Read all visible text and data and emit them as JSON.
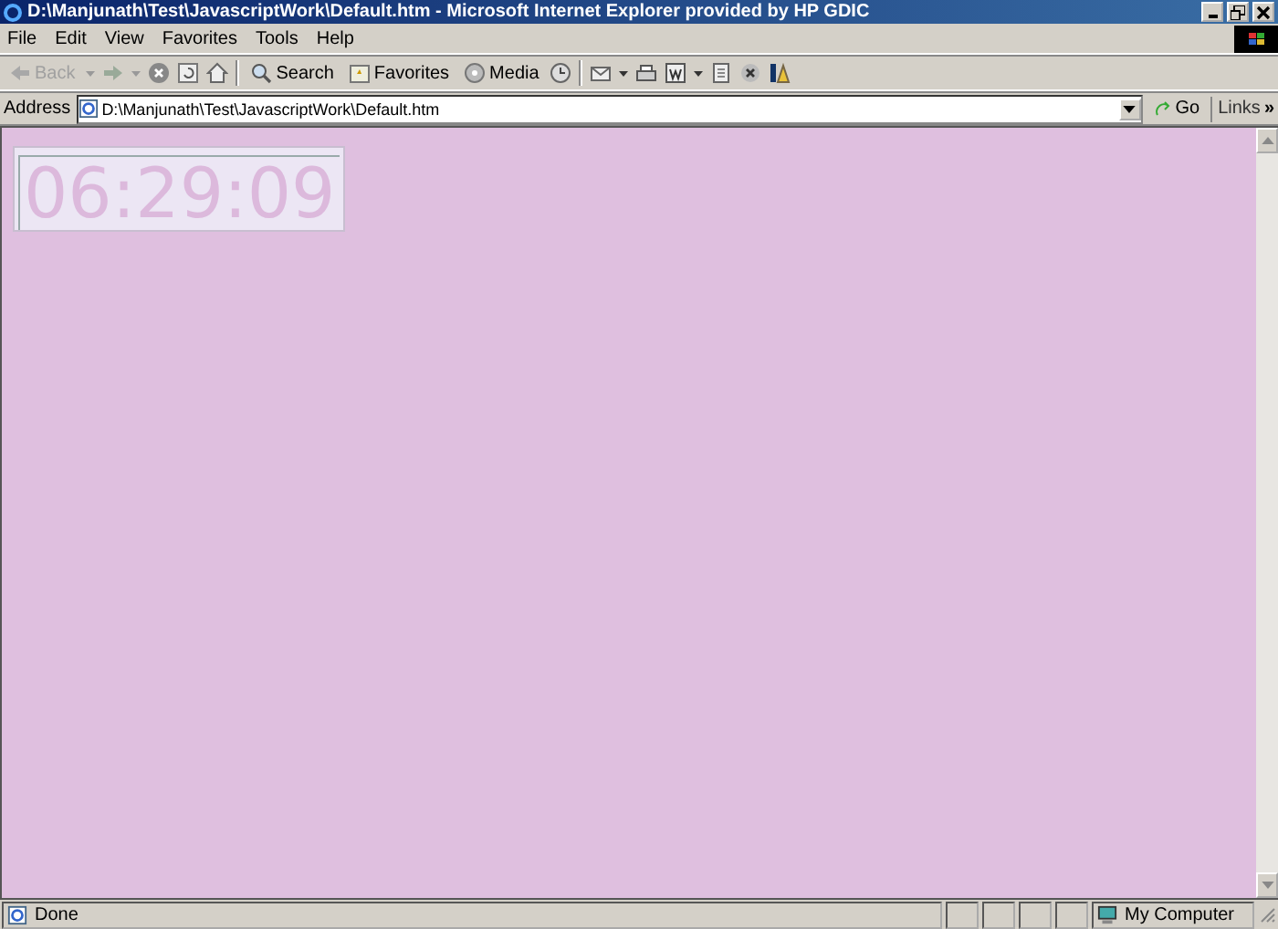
{
  "window": {
    "title": "D:\\Manjunath\\Test\\JavascriptWork\\Default.htm - Microsoft Internet Explorer provided by HP GDIC"
  },
  "menu": [
    {
      "label": "File"
    },
    {
      "label": "Edit"
    },
    {
      "label": "View"
    },
    {
      "label": "Favorites"
    },
    {
      "label": "Tools"
    },
    {
      "label": "Help"
    }
  ],
  "toolbar": {
    "back": {
      "label": "Back",
      "disabled": true
    },
    "search": {
      "label": "Search"
    },
    "favorites": {
      "label": "Favorites"
    },
    "media": {
      "label": "Media"
    }
  },
  "address": {
    "label": "Address",
    "value": "D:\\Manjunath\\Test\\JavascriptWork\\Default.htm",
    "go": "Go",
    "links": "Links",
    "more": "»"
  },
  "page": {
    "clock": "06:29:09"
  },
  "status_bar": {
    "text": "Done",
    "zone": "My Computer"
  }
}
